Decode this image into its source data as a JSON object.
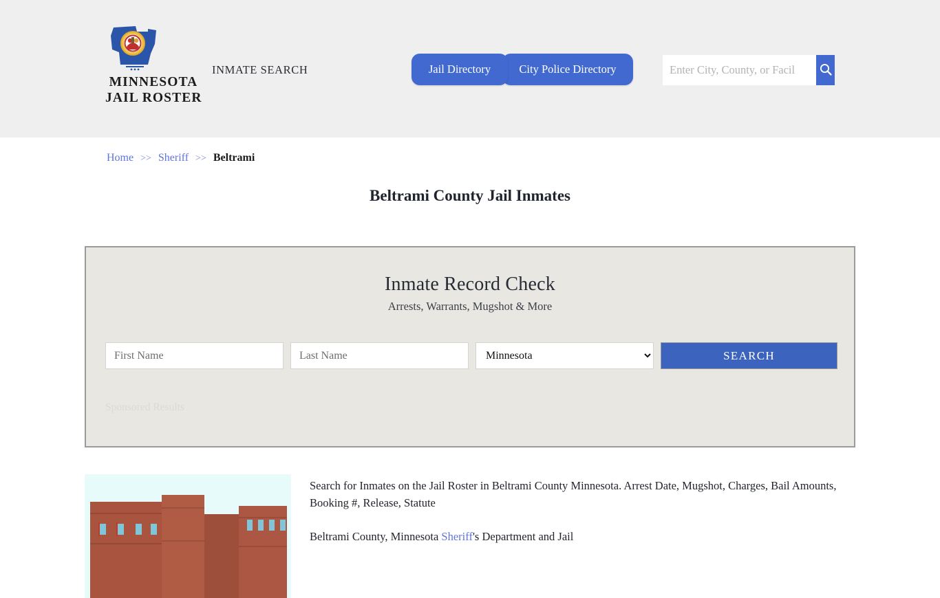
{
  "header": {
    "brand_line1": "MINNESOTA",
    "brand_line2": "JAIL ROSTER",
    "logo_icon": "minnesota-state-seal-icon",
    "tagline": "INMATE SEARCH",
    "nav": [
      {
        "label": "Jail Directory"
      },
      {
        "label": "City Police Directory"
      }
    ],
    "search": {
      "placeholder": "Enter City, County, or Facil",
      "value": "",
      "button_icon": "search-icon"
    }
  },
  "breadcrumb": {
    "items": [
      {
        "label": "Home",
        "link": true
      },
      {
        "label": "Sheriff",
        "link": true
      },
      {
        "label": "Beltrami",
        "link": false
      }
    ],
    "separator": ">>"
  },
  "page": {
    "title": "Beltrami County Jail Inmates"
  },
  "record_check": {
    "title": "Inmate Record Check",
    "subtitle": "Arrests, Warrants, Mugshot & More",
    "first_name_placeholder": "First Name",
    "first_name_value": "",
    "last_name_placeholder": "Last Name",
    "last_name_value": "",
    "state_selected": "Minnesota",
    "state_options": [
      "Minnesota"
    ],
    "search_button": "SEARCH",
    "sponsored_label": "Sponsored Results"
  },
  "content": {
    "thumb_icon": "jail-building-photo",
    "paragraph1": "Search for Inmates on the Jail Roster in Beltrami County Minnesota. Arrest Date, Mugshot, Charges, Bail Amounts, Booking #, Release, Statute",
    "paragraph2_before": "Beltrami County, Minnesota ",
    "paragraph2_link": "Sheriff",
    "paragraph2_after": "'s Department and Jail"
  },
  "colors": {
    "brand_blue": "#4169cf",
    "button_blue": "#3c63bd",
    "link_blue": "#5f75d8",
    "header_bg": "#efefef",
    "panel_bg": "#e9e7e1"
  }
}
